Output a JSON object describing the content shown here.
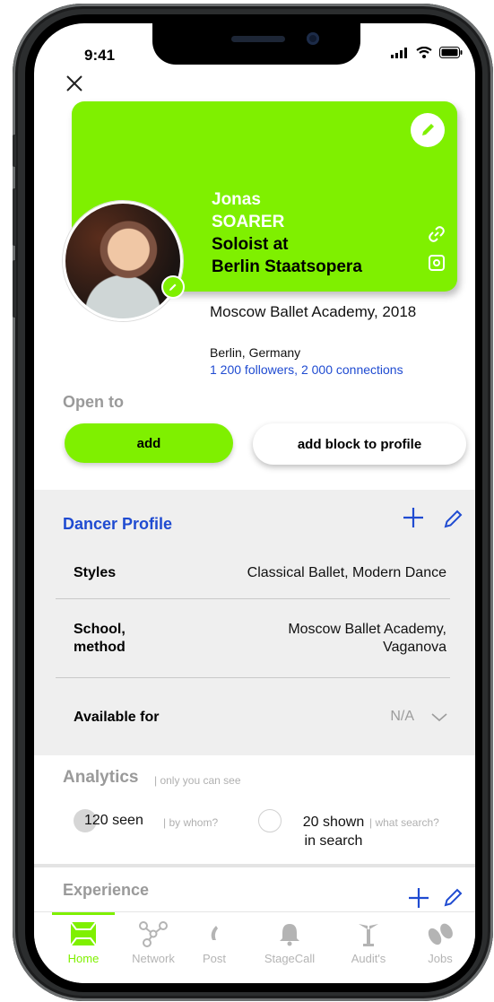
{
  "status_bar": {
    "time": "9:41"
  },
  "profile": {
    "first_name": "Jonas",
    "last_name": "SOARER",
    "role_line1": "Soloist at",
    "role_line2": "Berlin Staatsopera",
    "academy": "Moscow Ballet Academy, 2018",
    "location": "Berlin, Germany",
    "followers": "1 200 followers, 2 000 connections"
  },
  "open_to": {
    "title": "Open to",
    "add_label": "add",
    "add_block_label": "add block to profile"
  },
  "dancer_profile": {
    "title": "Dancer Profile",
    "rows": [
      {
        "label": "Styles",
        "value": "Classical Ballet, Modern Dance"
      },
      {
        "label_line1": "School,",
        "label_line2": "method",
        "value_line1": "Moscow Ballet Academy,",
        "value_line2": "Vaganova"
      },
      {
        "label": "Available for",
        "value": "N/A"
      }
    ]
  },
  "analytics": {
    "title": "Analytics",
    "subtitle": "| only you can see",
    "seen": "120 seen",
    "seen_hint": "| by whom?",
    "shown_line1": "20 shown",
    "shown_line2": "in search",
    "shown_hint": "| what search?"
  },
  "experience": {
    "title": "Experience"
  },
  "tabs": [
    {
      "label": "Home",
      "icon": "home-icon",
      "active": true
    },
    {
      "label": "Network",
      "icon": "network-icon",
      "active": false
    },
    {
      "label": "Post",
      "icon": "post-icon",
      "active": false
    },
    {
      "label": "StageCall",
      "icon": "bell-icon",
      "active": false
    },
    {
      "label": "Audit's",
      "icon": "audition-icon",
      "active": false
    },
    {
      "label": "Jobs",
      "icon": "jobs-icon",
      "active": false
    }
  ],
  "colors": {
    "accent": "#7ff000",
    "link": "#1f4bd1",
    "muted": "#9a9a9a"
  }
}
